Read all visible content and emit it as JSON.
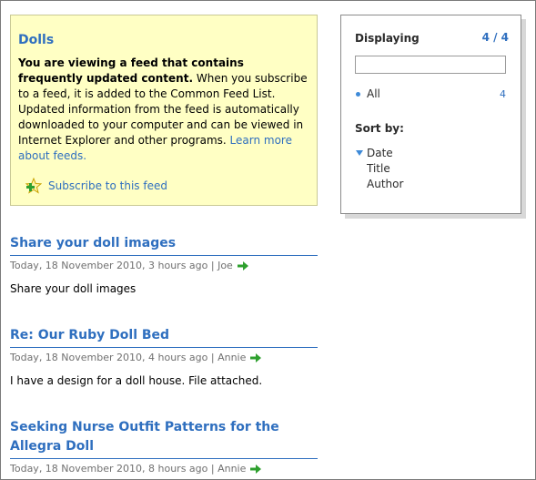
{
  "info": {
    "title": "Dolls",
    "bold_text": "You are viewing a feed that contains frequently updated content.",
    "body_text": " When you subscribe to a feed, it is added to the Common Feed List. Updated information from the feed is automatically downloaded to your computer and can be viewed in Internet Explorer and other programs. ",
    "learn_more_label": "Learn more about feeds.",
    "subscribe_label": "Subscribe to this feed",
    "subscribe_icon": "star-plus-icon"
  },
  "panel": {
    "displaying_label": "Displaying",
    "count": "4 / 4",
    "filter_value": "",
    "all_label": "All",
    "all_count": "4",
    "sort_by_label": "Sort by:",
    "sort_options": [
      "Date",
      "Title",
      "Author"
    ],
    "selected_sort": "Date"
  },
  "items": [
    {
      "title": "Share your doll images",
      "meta": "Today, 18 November 2010, 3 hours ago | Joe",
      "description": "Share your doll images"
    },
    {
      "title": "Re: Our Ruby Doll Bed",
      "meta": "Today, 18 November 2010, 4 hours ago | Annie",
      "description": "I have a design for a doll house. File attached."
    },
    {
      "title": "Seeking Nurse Outfit Patterns for the Allegra Doll",
      "meta": "Today, 18 November 2010, 8 hours ago | Annie",
      "description": ""
    }
  ],
  "colors": {
    "link_blue": "#2f6fbf",
    "info_background": "#ffffc4",
    "arrow_green": "#2ea02e"
  }
}
